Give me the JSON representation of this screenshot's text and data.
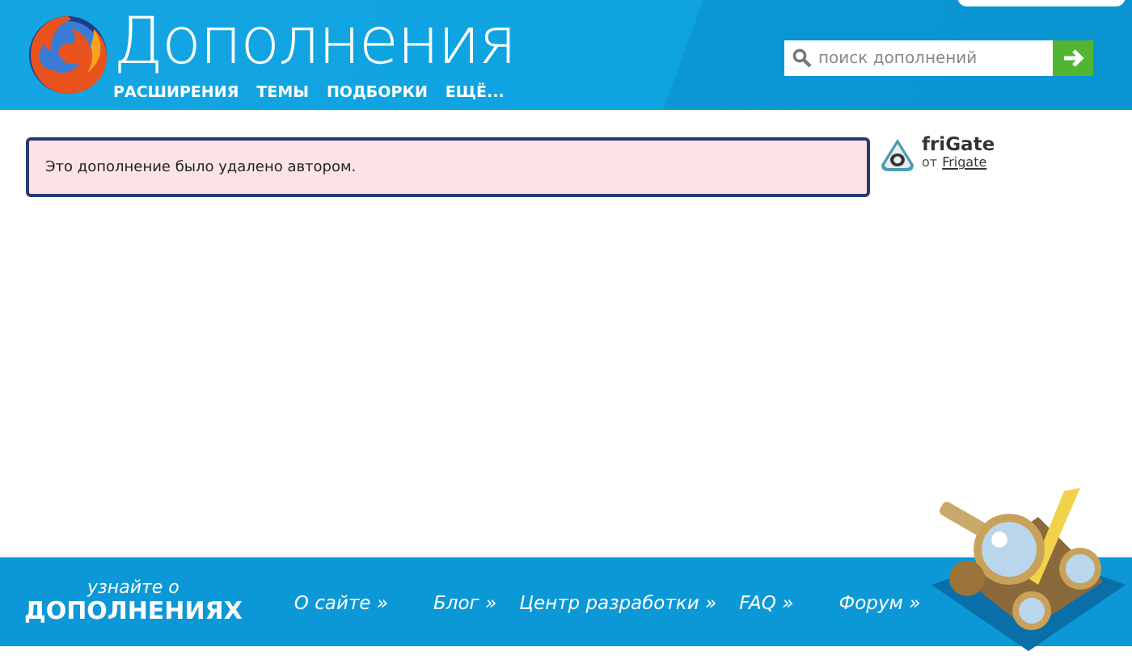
{
  "header": {
    "title": "Дополнения",
    "nav": [
      {
        "label": "РАСШИРЕНИЯ"
      },
      {
        "label": "ТЕМЫ"
      },
      {
        "label": "ПОДБОРКИ"
      },
      {
        "label": "ЕЩЁ..."
      }
    ],
    "search": {
      "placeholder": "поиск дополнений"
    }
  },
  "notice": {
    "message": "Это дополнение было удалено автором."
  },
  "addon": {
    "name": "friGate",
    "by": "от",
    "author": "Frigate"
  },
  "footer": {
    "tagline": "узнайте о",
    "heading": "ДОПОЛНЕНИЯХ",
    "links": [
      {
        "label": "О сайте »"
      },
      {
        "label": "Блог »"
      },
      {
        "label": "Центр разработки »"
      },
      {
        "label": "FAQ »"
      },
      {
        "label": "Форум »"
      }
    ]
  }
}
